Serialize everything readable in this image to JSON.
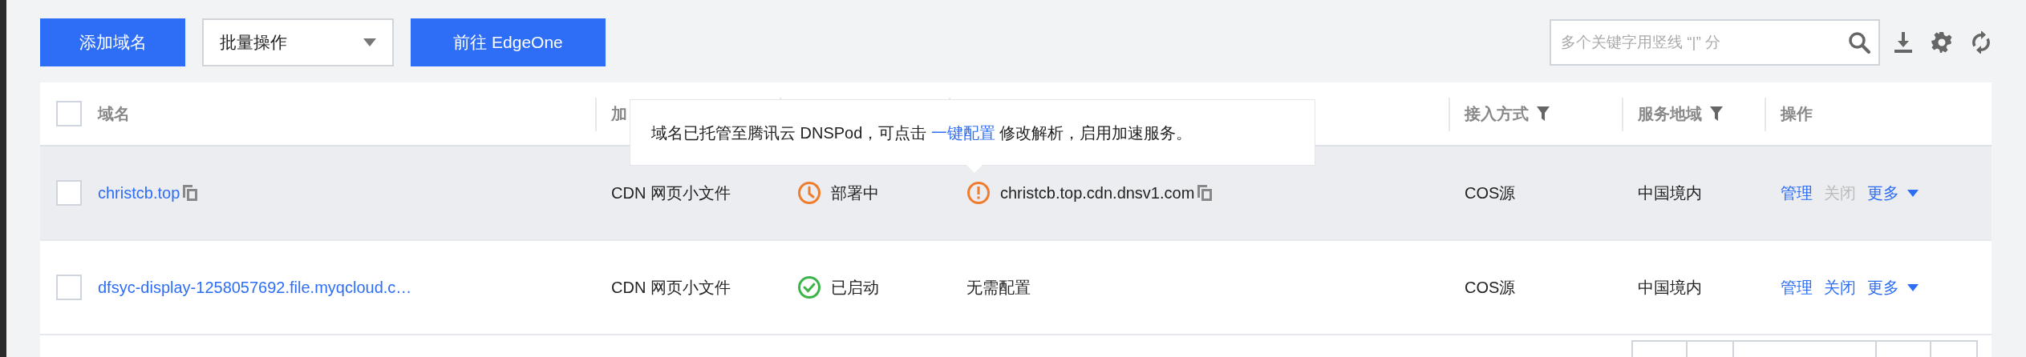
{
  "toolbar": {
    "add_button": "添加域名",
    "bulk_select": "批量操作",
    "edgeone_button": "前往 EdgeOne",
    "search": {
      "placeholder": "多个关键字用竖线 “|” 分"
    }
  },
  "table": {
    "select_all": {
      "checked": false
    },
    "columns": [
      {
        "label": "域名",
        "filter": false
      },
      {
        "label": "加"
      },
      {},
      {},
      {
        "label": "接入方式",
        "filter": true
      },
      {
        "label": "服务地域",
        "filter": true
      },
      {
        "label": "操作",
        "filter": false
      }
    ],
    "rows": [
      {
        "checked": false,
        "highlighted": true,
        "domain": "christcb.top",
        "domain_copy": true,
        "type": "CDN 网页小文件",
        "status": {
          "kind": "deploying",
          "text": "部署中"
        },
        "cname": {
          "warning": true,
          "text": "christcb.top.cdn.dnsv1.com",
          "copy": true
        },
        "access": "COS源",
        "region": "中国境内",
        "actions": [
          {
            "label": "管理",
            "disabled": false
          },
          {
            "label": "关闭",
            "disabled": true
          }
        ],
        "more": "更多"
      },
      {
        "checked": false,
        "highlighted": false,
        "domain": "dfsyc-display-1258057692.file.myqcloud.c…",
        "domain_copy": false,
        "type": "CDN 网页小文件",
        "status": {
          "kind": "running",
          "text": "已启动"
        },
        "cname": {
          "warning": false,
          "text": "无需配置",
          "copy": false
        },
        "access": "COS源",
        "region": "中国境内",
        "actions": [
          {
            "label": "管理",
            "disabled": false
          },
          {
            "label": "关闭",
            "disabled": false
          }
        ],
        "more": "更多"
      }
    ]
  },
  "tooltip": {
    "before": "域名已托管至腾讯云 DNSPod，可点击 ",
    "link": "一键配置",
    "after": " 修改解析，启用加速服务。"
  }
}
